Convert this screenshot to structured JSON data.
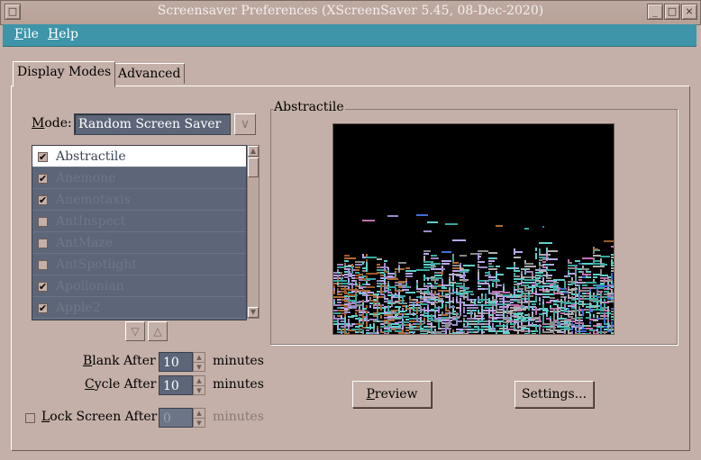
{
  "window": {
    "title": "Screensaver Preferences  (XScreenSaver 5.45, 08-Dec-2020)",
    "buttons": {
      "minimize": "_",
      "maximize": "□",
      "close": "×"
    }
  },
  "menubar": {
    "file": {
      "label": "File",
      "mnemonic": "F",
      "rest": "ile"
    },
    "help": {
      "label": "Help",
      "mnemonic": "H",
      "rest": "elp"
    }
  },
  "tabs": [
    {
      "label": "Display Modes",
      "active": true
    },
    {
      "label": "Advanced",
      "active": false
    }
  ],
  "mode": {
    "label_mnemonic": "M",
    "label_rest": "ode:",
    "value": "Random Screen Saver",
    "dropdown_glyph": "∨"
  },
  "saver_list": [
    {
      "name": "Abstractile",
      "checked": true,
      "selected": true
    },
    {
      "name": "Anemone",
      "checked": true,
      "selected": false
    },
    {
      "name": "Anemotaxis",
      "checked": true,
      "selected": false
    },
    {
      "name": "AntInspect",
      "checked": false,
      "selected": false
    },
    {
      "name": "AntMaze",
      "checked": false,
      "selected": false
    },
    {
      "name": "AntSpotlight",
      "checked": false,
      "selected": false
    },
    {
      "name": "Apollonian",
      "checked": true,
      "selected": false
    },
    {
      "name": "Apple2",
      "checked": true,
      "selected": false
    }
  ],
  "list_buttons": {
    "down": "▽",
    "up": "△"
  },
  "scroll_glyphs": {
    "up": "▲",
    "down": "▼"
  },
  "blank_after": {
    "mnemonic": "B",
    "rest": "lank After",
    "value": "10",
    "unit": "minutes"
  },
  "cycle_after": {
    "mnemonic": "C",
    "rest": "ycle After",
    "value": "10",
    "unit": "minutes"
  },
  "lock_screen": {
    "mnemonic": "L",
    "rest": "ock Screen After",
    "value": "0",
    "unit": "minutes",
    "checked": false
  },
  "preview_frame": {
    "title": "Abstractile"
  },
  "buttons": {
    "preview": {
      "mnemonic": "P",
      "rest": "review"
    },
    "settings": {
      "label": "Settings..."
    }
  },
  "colors": {
    "accent": "#3e94a8",
    "background": "#c4b0a8",
    "field": "#5d6679"
  }
}
